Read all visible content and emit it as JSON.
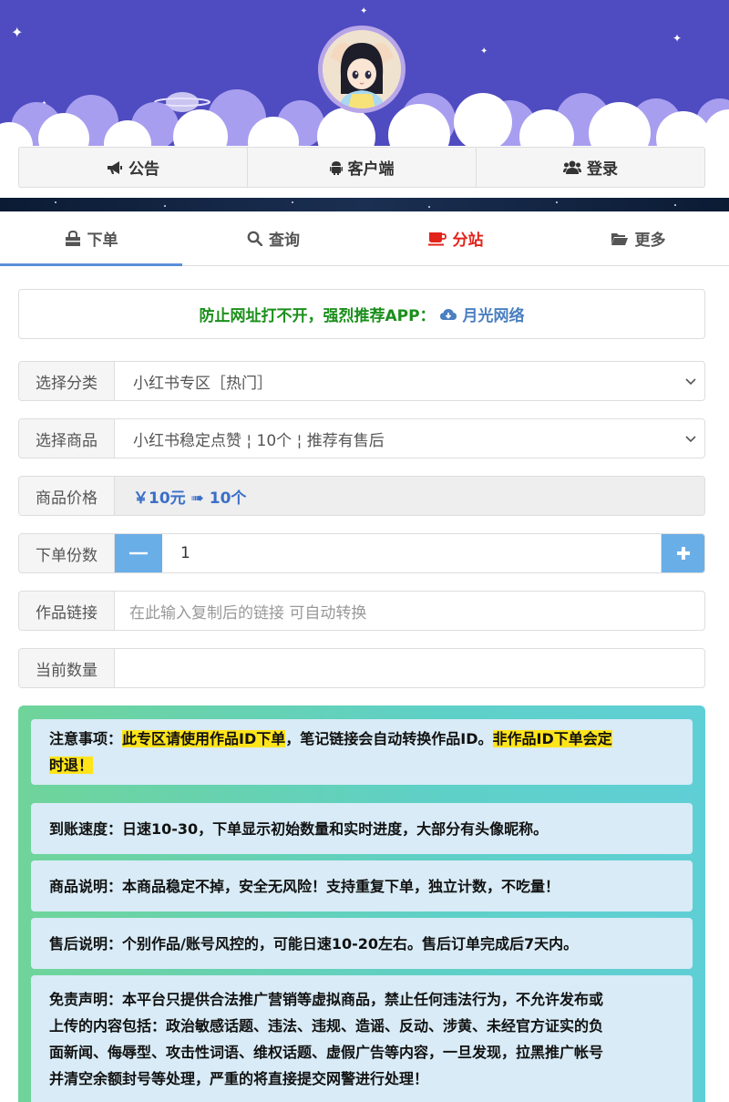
{
  "header": {
    "nav": [
      {
        "label": "公告",
        "icon": "megaphone-icon"
      },
      {
        "label": "客户端",
        "icon": "android-icon"
      },
      {
        "label": "登录",
        "icon": "users-icon"
      }
    ]
  },
  "tabs": [
    {
      "label": "下单",
      "icon": "shopping-bag-icon",
      "active": true
    },
    {
      "label": "查询",
      "icon": "search-icon"
    },
    {
      "label": "分站",
      "icon": "coffee-icon",
      "color": "#e2231a"
    },
    {
      "label": "更多",
      "icon": "folder-open-icon"
    }
  ],
  "notice": {
    "text": "防止网址打不开，强烈推荐APP：",
    "link": "月光网络",
    "link_icon": "cloud-download-icon"
  },
  "form": {
    "category_label": "选择分类",
    "category_value": "小红书专区［热门］",
    "product_label": "选择商品",
    "product_value": "小红书稳定点赞 ¦ 10个 ¦ 推荐有售后",
    "price_label": "商品价格",
    "price_value": "￥10元 ➠ 10个",
    "qty_label": "下单份数",
    "qty_value": "1",
    "link_label": "作品链接",
    "link_placeholder": "在此输入复制后的链接 可自动转换",
    "count_label": "当前数量",
    "count_value": ""
  },
  "info": {
    "card1_prefix": "注意事项：",
    "card1_hl1": "此专区请使用作品ID下单",
    "card1_mid": "，笔记链接会自动转换作品ID。",
    "card1_hl2a": "非作品ID下单会定",
    "card1_hl2b": "时退！",
    "card2": "到账速度：日速10-30，下单显示初始数量和实时进度，大部分有头像昵称。",
    "card3": "商品说明：本商品稳定不掉，安全无风险！支持重复下单，独立计数，不吃量！",
    "card4": "售后说明：个别作品/账号风控的，可能日速10-20左右。售后订单完成后7天内。",
    "card5_l1": "免责声明：本平台只提供合法推广营销等虚拟商品，禁止任何违法行为，不允许发布或",
    "card5_l2": "上传的内容包括：政治敏感话题、违法、违规、造谣、反动、涉黄、未经官方证实的负",
    "card5_l3": "面新闻、侮辱型、攻击性词语、维权话题、虚假广告等内容，一旦发现，拉黑推广帐号",
    "card5_l4": "并清空余额封号等处理，严重的将直接提交网警进行处理！"
  },
  "colors": {
    "banner": "#4f4bc0",
    "accent_blue": "#5b8fd6",
    "active_red": "#e2231a",
    "notice_green": "#1a8f1a",
    "highlight": "#ffe41a"
  }
}
